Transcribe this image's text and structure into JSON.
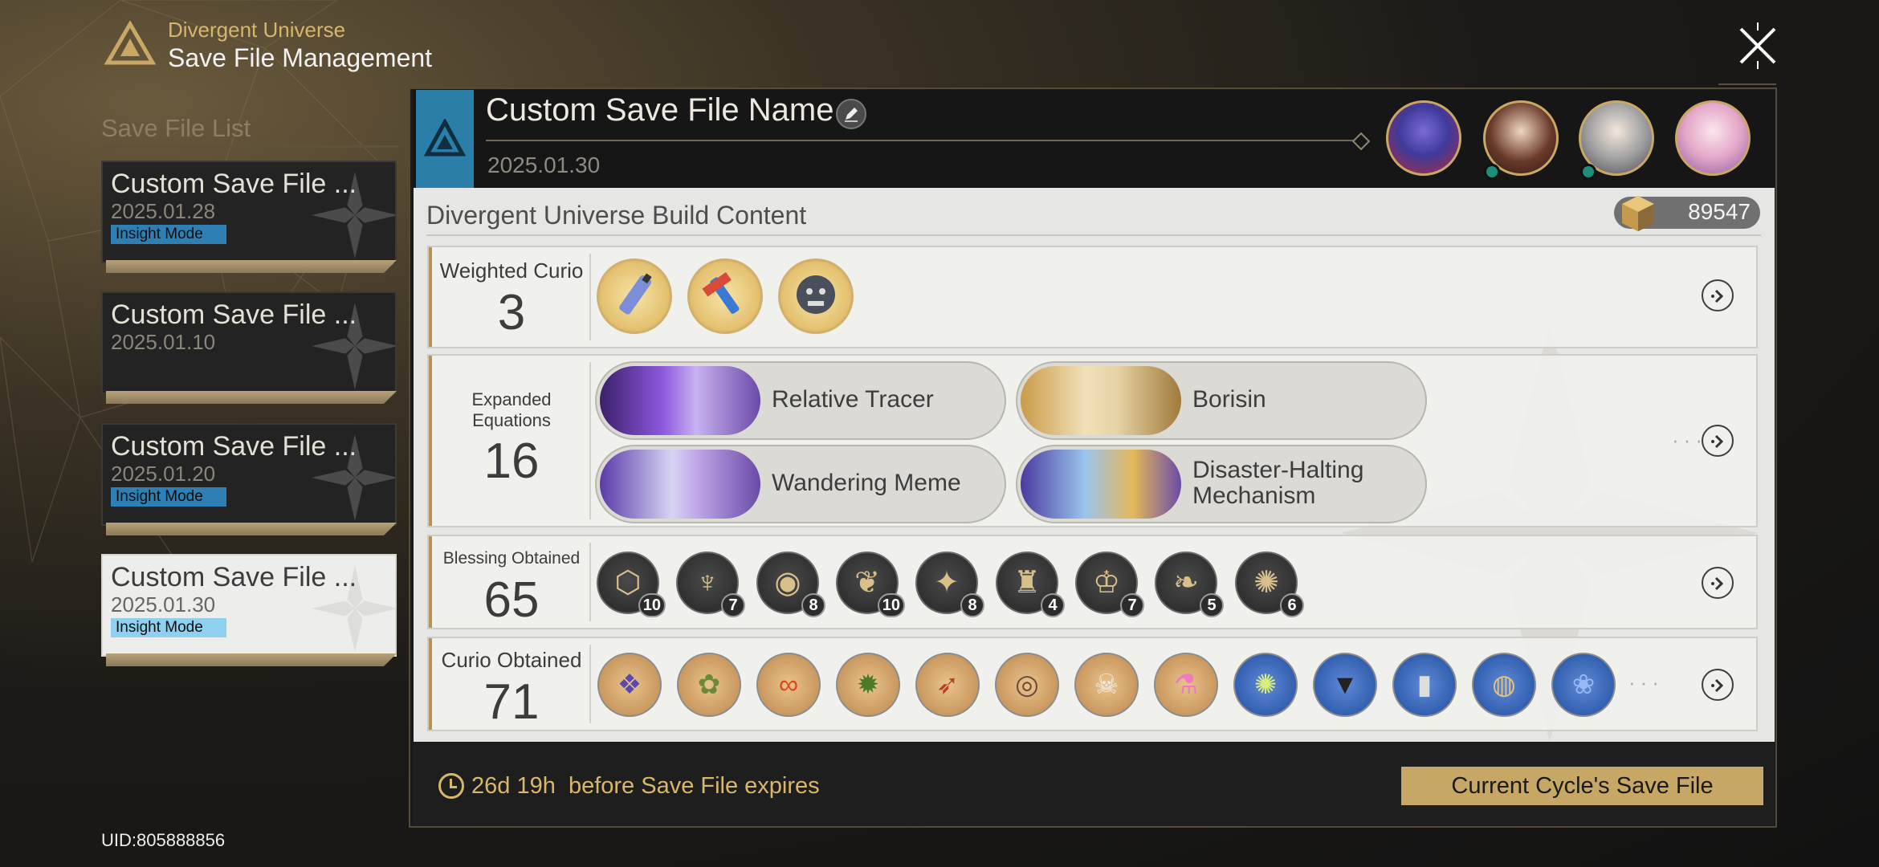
{
  "header": {
    "subtitle": "Divergent Universe",
    "title": "Save File Management",
    "close_icon": "close-x-icon"
  },
  "save_list": {
    "title": "Save File List",
    "items": [
      {
        "name": "Custom Save File ...",
        "date": "2025.01.28",
        "badge": "Insight Mode",
        "selected": false
      },
      {
        "name": "Custom Save File ...",
        "date": "2025.01.10",
        "badge": "",
        "selected": false
      },
      {
        "name": "Custom Save File ...",
        "date": "2025.01.20",
        "badge": "Insight Mode",
        "selected": false
      },
      {
        "name": "Custom Save File ...",
        "date": "2025.01.30",
        "badge": "Insight Mode",
        "selected": true
      }
    ]
  },
  "uid": "UID:805888856",
  "panel": {
    "name": "Custom Save File Name",
    "date": "2025.01.30",
    "edit_icon": "pencil-icon",
    "build_title": "Divergent Universe Build Content",
    "points": "89547",
    "points_icon": "cosmic-fragment-icon"
  },
  "weighted_curio": {
    "label": "Weighted Curio",
    "count": "3",
    "icons": [
      "paint-tube-icon",
      "brush-hammer-icon",
      "stone-lion-icon"
    ]
  },
  "equations": {
    "label": "Expanded Equations",
    "count": "16",
    "items": [
      {
        "name": "Relative Tracer"
      },
      {
        "name": "Borisin"
      },
      {
        "name": "Wandering Meme"
      },
      {
        "name": "Disaster-Halting Mechanism"
      }
    ]
  },
  "blessings": {
    "label": "Blessing Obtained",
    "count": "65",
    "items": [
      {
        "icon": "preservation-path-icon",
        "count": "10"
      },
      {
        "icon": "remembrance-path-icon",
        "count": "7"
      },
      {
        "icon": "nihility-path-icon",
        "count": "8"
      },
      {
        "icon": "abundance-path-icon",
        "count": "10"
      },
      {
        "icon": "hunt-path-icon",
        "count": "8"
      },
      {
        "icon": "destruction-path-icon",
        "count": "4"
      },
      {
        "icon": "elation-path-icon",
        "count": "7"
      },
      {
        "icon": "propagation-path-icon",
        "count": "5"
      },
      {
        "icon": "erudition-path-icon",
        "count": "6"
      }
    ]
  },
  "curios": {
    "label": "Curio Obtained",
    "count": "71",
    "items": [
      {
        "icon": "cloak-icon",
        "tone": "gold"
      },
      {
        "icon": "vine-knot-icon",
        "tone": "gold"
      },
      {
        "icon": "ribbon-icon",
        "tone": "gold"
      },
      {
        "icon": "green-rock-icon",
        "tone": "gold"
      },
      {
        "icon": "feather-icon",
        "tone": "gold"
      },
      {
        "icon": "goggles-icon",
        "tone": "gold"
      },
      {
        "icon": "skeleton-icon",
        "tone": "gold"
      },
      {
        "icon": "potion-icon",
        "tone": "gold"
      },
      {
        "icon": "orb-icon",
        "tone": "blue"
      },
      {
        "icon": "crystal-shard-icon",
        "tone": "blue"
      },
      {
        "icon": "tube-icon",
        "tone": "blue"
      },
      {
        "icon": "coins-icon",
        "tone": "blue"
      },
      {
        "icon": "blue-rose-icon",
        "tone": "blue"
      }
    ]
  },
  "footer": {
    "expire_text": "26d 19h  before Save File expires",
    "button": "Current Cycle's Save File"
  },
  "colors": {
    "accent_gold": "#c7a765",
    "insight_badge": "#2e7fb3",
    "logo_blue": "#2b7ea8"
  }
}
